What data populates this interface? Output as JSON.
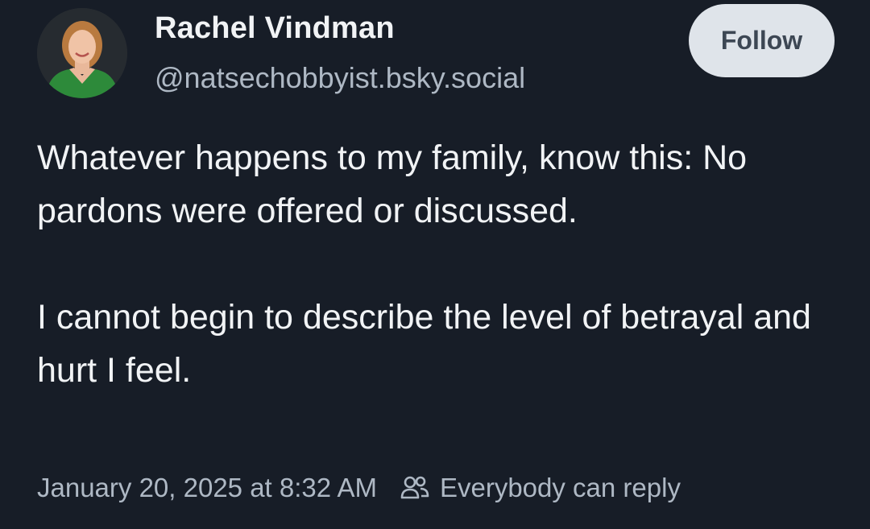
{
  "post": {
    "author": {
      "display_name": "Rachel Vindman",
      "handle": "@natsechobbyist.bsky.social"
    },
    "follow_label": "Follow",
    "text": {
      "paragraph_1": "Whatever happens to my family, know this: No pardons were offered or discussed.",
      "paragraph_2": "I cannot begin to describe the level of betrayal and hurt I feel."
    },
    "timestamp": "January 20, 2025 at 8:32 AM",
    "reply_setting": "Everybody can reply"
  },
  "colors": {
    "background": "#171d27",
    "text_primary": "#f1f3f5",
    "text_secondary": "#aeb8c4",
    "follow_button_bg": "#dfe4ea"
  },
  "icons": {
    "avatar": "profile-photo",
    "reply_setting": "people-icon"
  }
}
